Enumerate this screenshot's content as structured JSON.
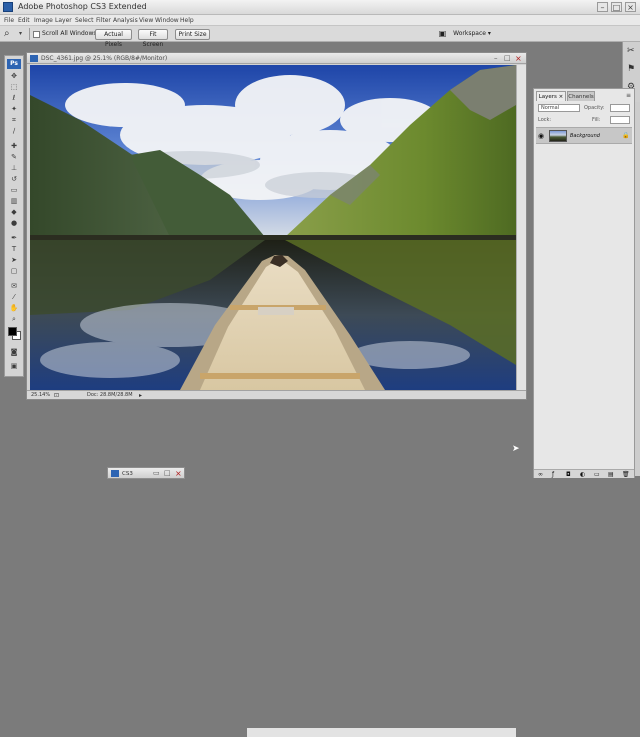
{
  "app": {
    "title": "Adobe Photoshop CS3 Extended",
    "window_controls": [
      "minimize-icon",
      "maximize-icon",
      "close-icon"
    ]
  },
  "menu": [
    "File",
    "Edit",
    "Image",
    "Layer",
    "Select",
    "Filter",
    "Analysis",
    "View",
    "Window",
    "Help"
  ],
  "options_bar": {
    "scroll_all_windows": "Scroll All Windows",
    "actual_pixels": "Actual Pixels",
    "fit_screen": "Fit Screen",
    "print_size": "Print Size",
    "workspace": "Workspace ▾"
  },
  "document": {
    "title": "DSC_4361.jpg @ 25.1% (RGB/8#/Monitor)",
    "zoom": "25.14%",
    "doc_size": "Doc: 28.8M/28.8M",
    "window_controls": [
      "minimize-icon",
      "maximize-icon",
      "close-icon"
    ]
  },
  "layers_panel": {
    "tabs": [
      "Layers ×",
      "Channels"
    ],
    "blend_mode": "Normal",
    "opacity_label": "Opacity:",
    "lock_label": "Lock:",
    "fill_label": "Fill:",
    "layer_name": "Background"
  },
  "minimized_doc": {
    "title": "CS3"
  },
  "colors": {
    "app_background": "#7b7b7b",
    "panel": "#d4d4d4",
    "ps_blue": "#2d64b3"
  }
}
